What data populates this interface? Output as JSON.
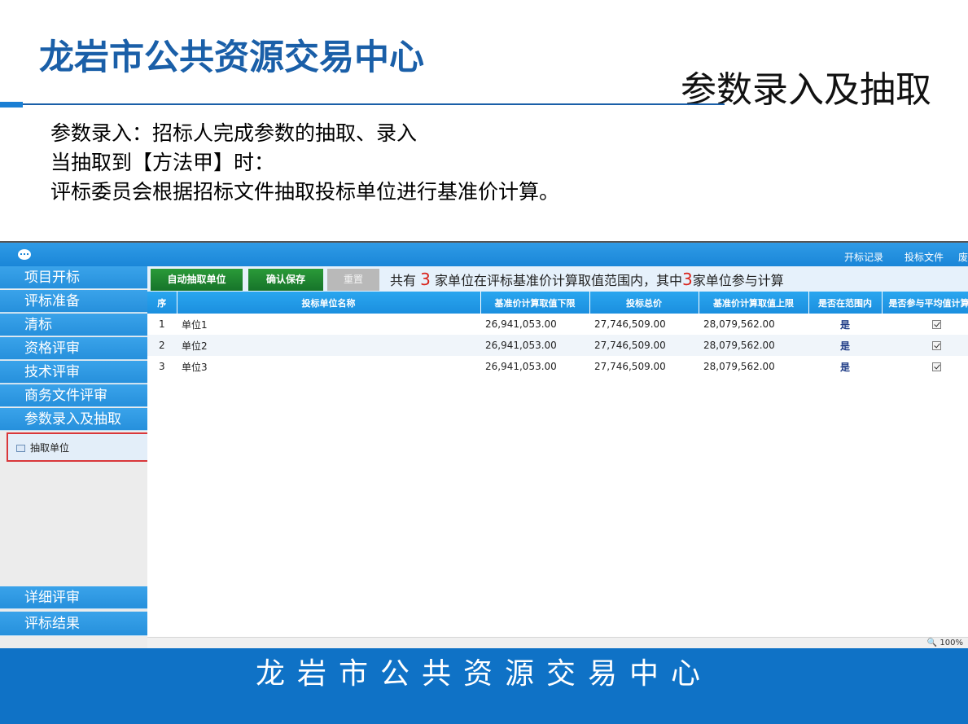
{
  "slide": {
    "org_title": "龙岩市公共资源交易中心",
    "section_title": "参数录入及抽取",
    "intro_lines": [
      "参数录入：招标人完成参数的抽取、录入",
      "当抽取到【方法甲】时：",
      "评标委员会根据招标文件抽取投标单位进行基准价计算。"
    ],
    "footer": "龙岩市公共资源交易中心"
  },
  "app": {
    "top_links": [
      "开标记录",
      "投标文件",
      "废"
    ],
    "sidebar": {
      "items": [
        "项目开标",
        "评标准备",
        "清标",
        "资格评审",
        "技术评审",
        "商务文件评审",
        "参数录入及抽取"
      ],
      "sub_item": "抽取单位",
      "bottom_items": [
        "详细评审",
        "评标结果"
      ]
    },
    "toolbar": {
      "auto_extract_label": "自动抽取单位",
      "confirm_save_label": "确认保存",
      "reset_label": "重置",
      "summary_prefix": "共有",
      "summary_count1": "3",
      "summary_middle": "家单位在评标基准价计算取值范围内，其中",
      "summary_count2": "3",
      "summary_suffix": "家单位参与计算"
    },
    "table": {
      "headers": [
        "序",
        "投标单位名称",
        "基准价计算取值下限",
        "投标总价",
        "基准价计算取值上限",
        "是否在范围内",
        "是否参与平均值计算"
      ],
      "rows": [
        {
          "no": "1",
          "name": "单位1",
          "lower": "26,941,053.00",
          "total": "27,746,509.00",
          "upper": "28,079,562.00",
          "in_range": "是",
          "participate": true
        },
        {
          "no": "2",
          "name": "单位2",
          "lower": "26,941,053.00",
          "total": "27,746,509.00",
          "upper": "28,079,562.00",
          "in_range": "是",
          "participate": true
        },
        {
          "no": "3",
          "name": "单位3",
          "lower": "26,941,053.00",
          "total": "27,746,509.00",
          "upper": "28,079,562.00",
          "in_range": "是",
          "participate": true
        }
      ]
    },
    "zoom": "100%"
  }
}
